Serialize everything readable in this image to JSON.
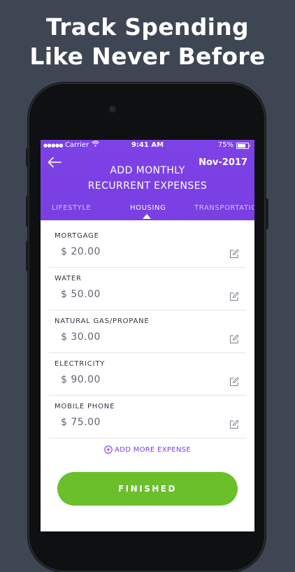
{
  "promo": {
    "line1": "Track Spending",
    "line2": "Like Never Before"
  },
  "status_bar": {
    "carrier": "Carrier",
    "time": "9:41 AM",
    "battery": "75%"
  },
  "header": {
    "back_icon": "left-arrow-icon",
    "month": "Nov-2017",
    "title_line1": "ADD MONTHLY",
    "title_line2": "RECURRENT EXPENSES"
  },
  "tabs": [
    {
      "label": "LIFESTYLE",
      "active": false
    },
    {
      "label": "HOUSING",
      "active": true
    },
    {
      "label": "TRANSPORTATIO",
      "active": false
    }
  ],
  "expenses": [
    {
      "label": "MORTGAGE",
      "value": "$ 20.00"
    },
    {
      "label": "WATER",
      "value": "$ 50.00"
    },
    {
      "label": "NATURAL GAS/PROPANE",
      "value": "$ 30.00"
    },
    {
      "label": "ELECTRICITY",
      "value": "$ 90.00"
    },
    {
      "label": "MOBILE PHONE",
      "value": "$ 75.00"
    }
  ],
  "add_more_label": "ADD MORE EXPENSE",
  "finish_label": "FINISHED",
  "colors": {
    "accent": "#7b3fe4",
    "button": "#6abf2b",
    "background": "#3f4653"
  }
}
